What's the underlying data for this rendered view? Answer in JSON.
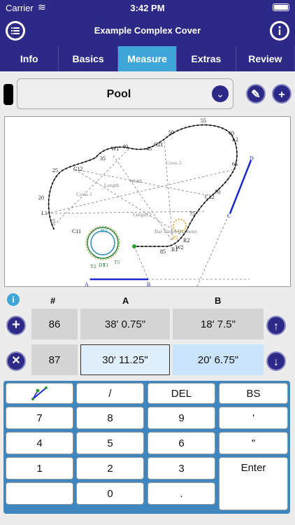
{
  "status": {
    "carrier": "Carrier",
    "time": "3:42 PM"
  },
  "nav": {
    "title": "Example Complex Cover"
  },
  "tabs": [
    "Info",
    "Basics",
    "Measure",
    "Extras",
    "Review"
  ],
  "object": {
    "selected": "Pool"
  },
  "columns": {
    "num": "#",
    "a": "A",
    "b": "B"
  },
  "rows": [
    {
      "num": "86",
      "a": "38' 0.75\"",
      "b": "18' 7.5\""
    },
    {
      "num": "87",
      "a": "30' 11.25\"",
      "b": "20' 6.75\""
    }
  ],
  "keys": {
    "slash": "/",
    "del": "DEL",
    "bs": "BS",
    "k7": "7",
    "k8": "8",
    "k9": "9",
    "quote1": "'",
    "k4": "4",
    "k5": "5",
    "k6": "6",
    "quote2": "\"",
    "k1": "1",
    "k2": "2",
    "k3": "3",
    "enter": "Enter",
    "k0": "0",
    "dot": "."
  },
  "drawing": {
    "labels": {
      "n55": "55",
      "n60": "60",
      "l2": "L2",
      "n50": "50",
      "c21": "C21",
      "n45": "45",
      "w1": "W1",
      "n40": "40",
      "n35": "35",
      "c12": "C12",
      "n25": "25",
      "n20": "20",
      "l1": "L1",
      "n15": "15",
      "n65": "65",
      "n70": "70",
      "c22": "C22",
      "n75": "75",
      "cross2": "Cross 2",
      "cross1": "Cross 1",
      "width": "Width",
      "length": "Length",
      "length2": "Length 2",
      "bar": "Bar Target Diameter",
      "c11": "C11",
      "r1": "R1",
      "r2": "R2",
      "w2": "W2",
      "n85": "85",
      "t2": "T2",
      "d1": "D1",
      "a": "A",
      "b": "B",
      "c": "C",
      "d": "D",
      "t1": "T1",
      "t5": "T5",
      "p1": "P1",
      "d2": "D2"
    }
  },
  "colors": {
    "nav": "#2d2a87",
    "tabActive": "#3ea6d8",
    "keypad": "#3d86bf"
  }
}
